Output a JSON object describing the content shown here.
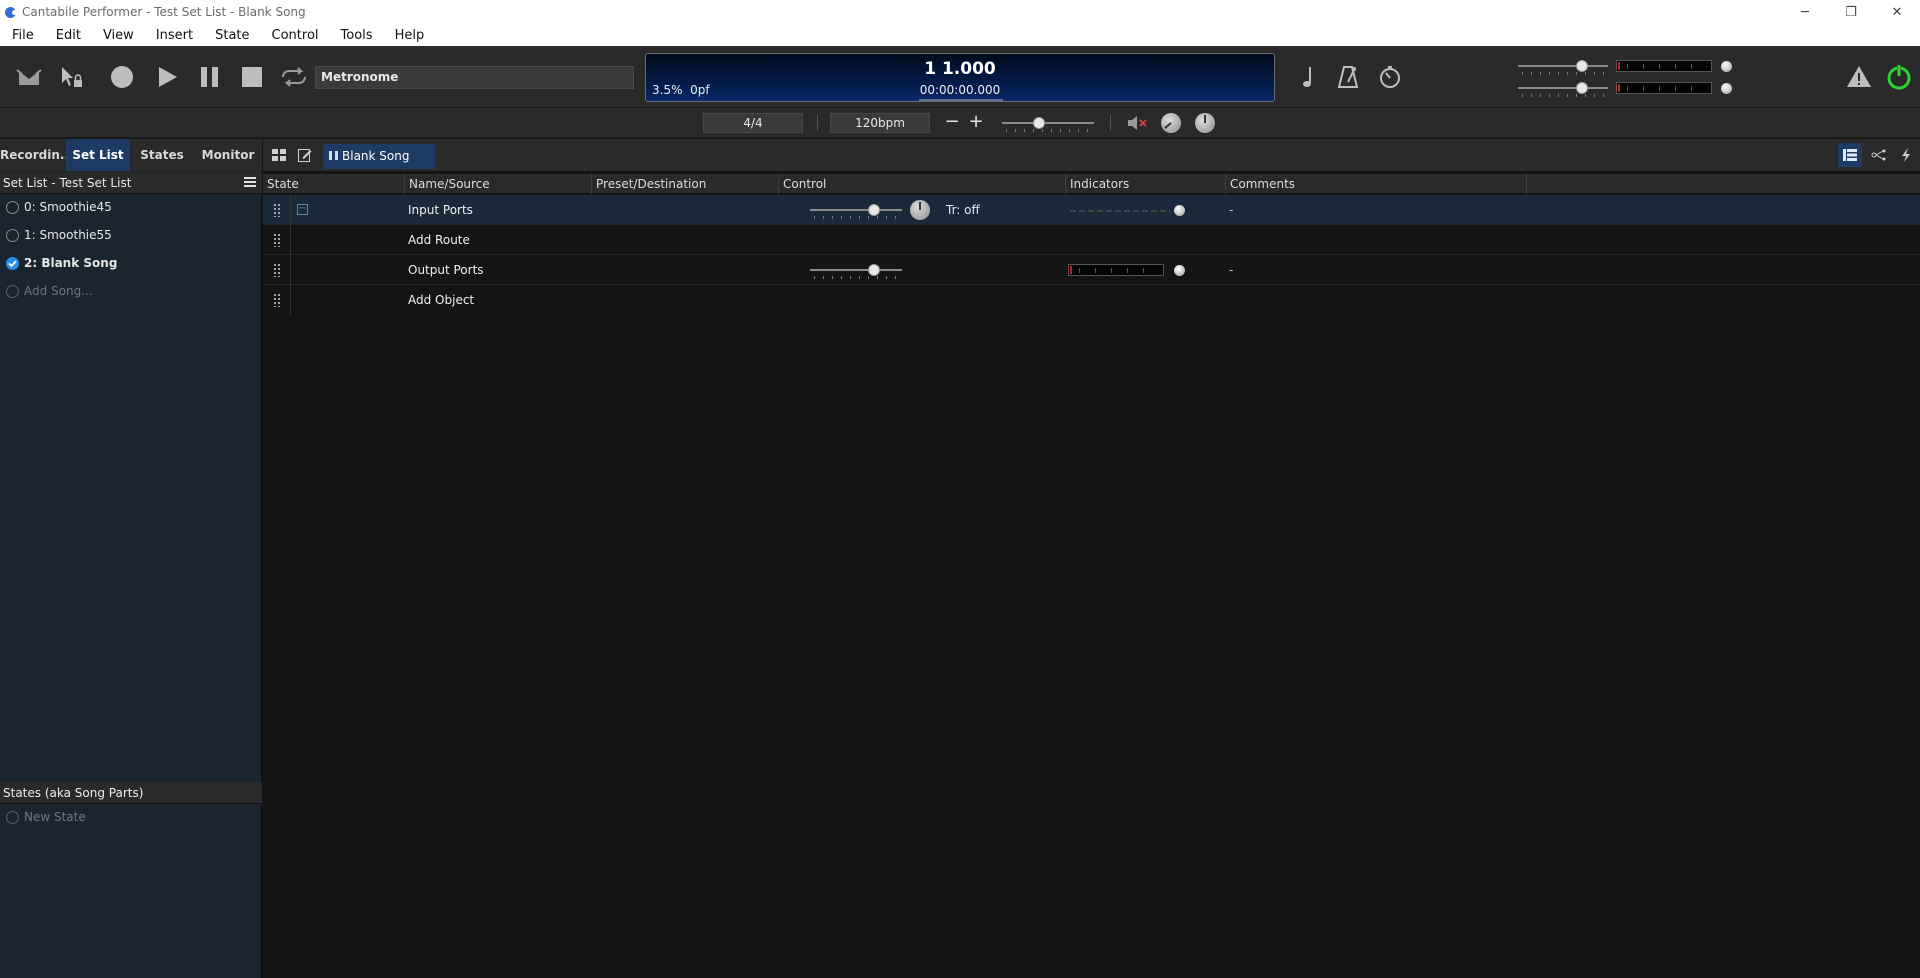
{
  "window": {
    "title": "Cantabile Performer - Test Set List - Blank Song",
    "controls": {
      "minimize": "─",
      "restore": "❐",
      "close": "✕"
    }
  },
  "menu": [
    "File",
    "Edit",
    "View",
    "Insert",
    "State",
    "Control",
    "Tools",
    "Help"
  ],
  "transport": {
    "metronome_label": "Metronome",
    "position": "1 1.000",
    "cpu": "3.5%",
    "pf": "0pf",
    "time": "00:00:00.000"
  },
  "tempo": {
    "time_signature": "4/4",
    "bpm": "120bpm",
    "minus": "−",
    "plus": "+"
  },
  "tabs": [
    {
      "label": "Recordin...",
      "active": false
    },
    {
      "label": "Set List",
      "active": true
    },
    {
      "label": "States",
      "active": false
    },
    {
      "label": "Monitor",
      "active": false
    }
  ],
  "setlist": {
    "header": "Set List - Test Set List",
    "songs": [
      {
        "label": "0: Smoothie45",
        "checked": false
      },
      {
        "label": "1: Smoothie55",
        "checked": false
      },
      {
        "label": "2: Blank Song",
        "checked": true
      }
    ],
    "add_song": "Add Song..."
  },
  "states": {
    "header": "States (aka Song Parts)",
    "new_state": "New State"
  },
  "song_tab": "Blank Song",
  "columns": [
    "State",
    "Name/Source",
    "Preset/Destination",
    "Control",
    "Indicators",
    "Comments"
  ],
  "rows": [
    {
      "name": "Input Ports",
      "tr": "Tr: off",
      "comment": "-"
    },
    {
      "name": "Add Route"
    },
    {
      "name": "Output Ports",
      "comment": "-"
    },
    {
      "name": "Add Object"
    }
  ],
  "colors": {
    "accent_blue": "#1e3b63",
    "check_blue": "#2a8fe6",
    "power_green": "#2fd32f",
    "panel_bg": "#1b2530"
  }
}
